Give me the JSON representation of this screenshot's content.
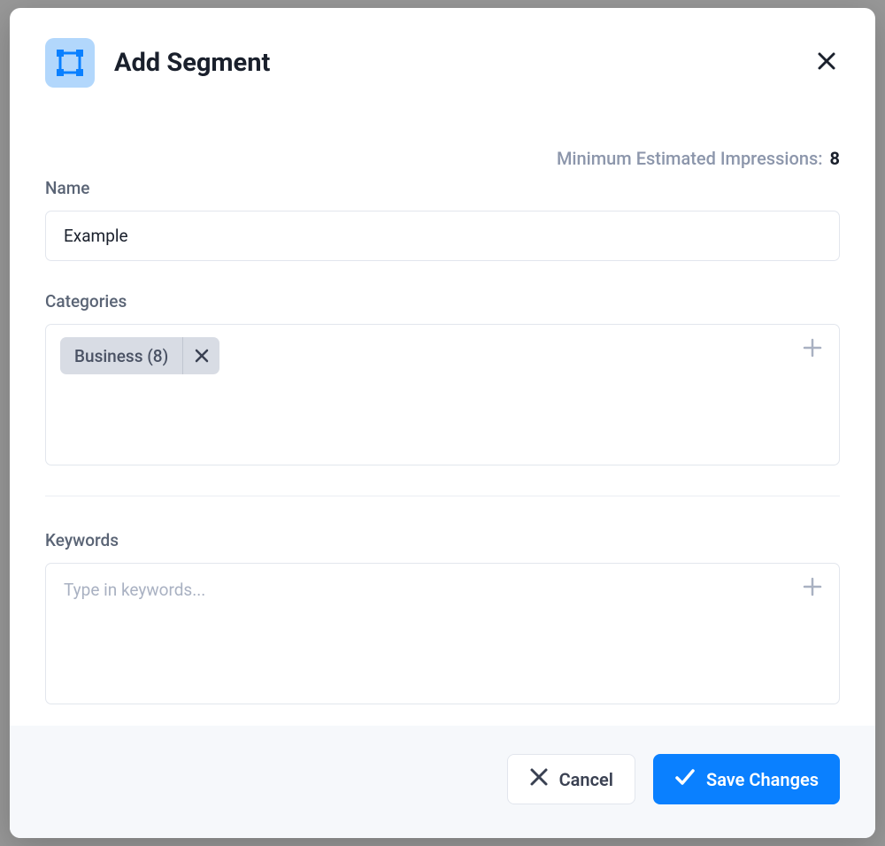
{
  "header": {
    "title": "Add Segment"
  },
  "impressions": {
    "label": "Minimum Estimated Impressions:",
    "value": "8"
  },
  "fields": {
    "name": {
      "label": "Name",
      "value": "Example"
    },
    "categories": {
      "label": "Categories",
      "tags": [
        {
          "label": "Business (8)"
        }
      ]
    },
    "keywords": {
      "label": "Keywords",
      "placeholder": "Type in keywords..."
    }
  },
  "footer": {
    "cancel": "Cancel",
    "save": "Save Changes"
  }
}
